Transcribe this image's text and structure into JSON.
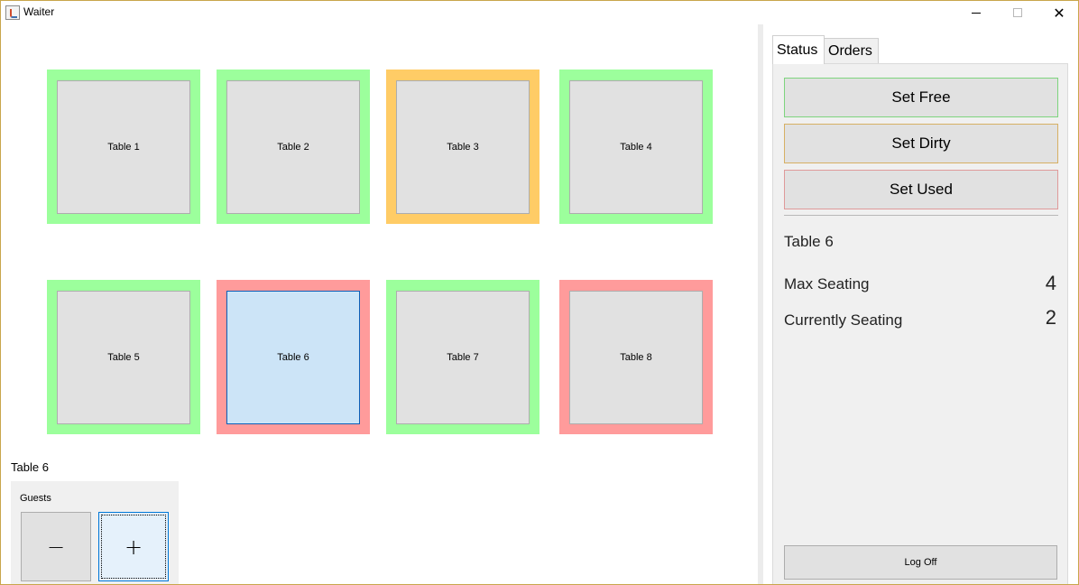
{
  "window": {
    "title": "Waiter",
    "app_icon": "java-cup-icon"
  },
  "tables": [
    {
      "label": "Table 1",
      "status": "free"
    },
    {
      "label": "Table 2",
      "status": "free"
    },
    {
      "label": "Table 3",
      "status": "dirty"
    },
    {
      "label": "Table 4",
      "status": "free"
    },
    {
      "label": "Table 5",
      "status": "free"
    },
    {
      "label": "Table 6",
      "status": "used",
      "selected": true
    },
    {
      "label": "Table 7",
      "status": "free"
    },
    {
      "label": "Table 8",
      "status": "used"
    }
  ],
  "status_colors": {
    "free": "#9cff9c",
    "dirty": "#ffcc66",
    "used": "#ff9b9b",
    "selected": "#cce4f7"
  },
  "selected_table": {
    "label": "Table 6"
  },
  "guests": {
    "label": "Guests",
    "minus_label": "−",
    "plus_label": "+"
  },
  "tabs": [
    {
      "label": "Status",
      "active": true
    },
    {
      "label": "Orders",
      "active": false
    }
  ],
  "status_panel": {
    "set_free_label": "Set Free",
    "set_dirty_label": "Set Dirty",
    "set_used_label": "Set Used",
    "table_name": "Table 6",
    "max_seating_label": "Max Seating",
    "max_seating_value": "4",
    "currently_seating_label": "Currently Seating",
    "currently_seating_value": "2"
  },
  "logoff_label": "Log Off"
}
